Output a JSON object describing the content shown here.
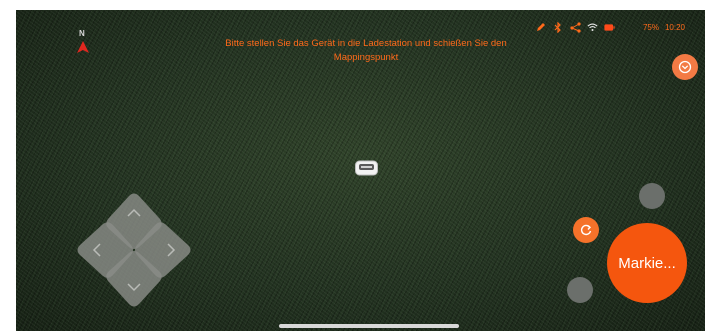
{
  "compass": {
    "north_label": "N",
    "icon": "compass-arrow-icon"
  },
  "instruction": {
    "line1": "Bitte stellen Sie das Gerät in die Ladestation und schießen Sie den",
    "line2": "Mappingspunkt"
  },
  "status_bar": {
    "icons": [
      "pen-icon",
      "bluetooth-icon",
      "share-icon",
      "wifi-icon",
      "battery-icon"
    ],
    "signal": "75%",
    "time": "10:20"
  },
  "controls": {
    "mark_button_label": "Markie...",
    "dpad": [
      "up-arrow",
      "left-arrow",
      "right-arrow",
      "down-arrow"
    ]
  },
  "colors": {
    "accent": "#f5560e",
    "text_orange": "#ff6a1a",
    "gray_button": "#6b6f6b",
    "dpad": "#8a8c88"
  }
}
